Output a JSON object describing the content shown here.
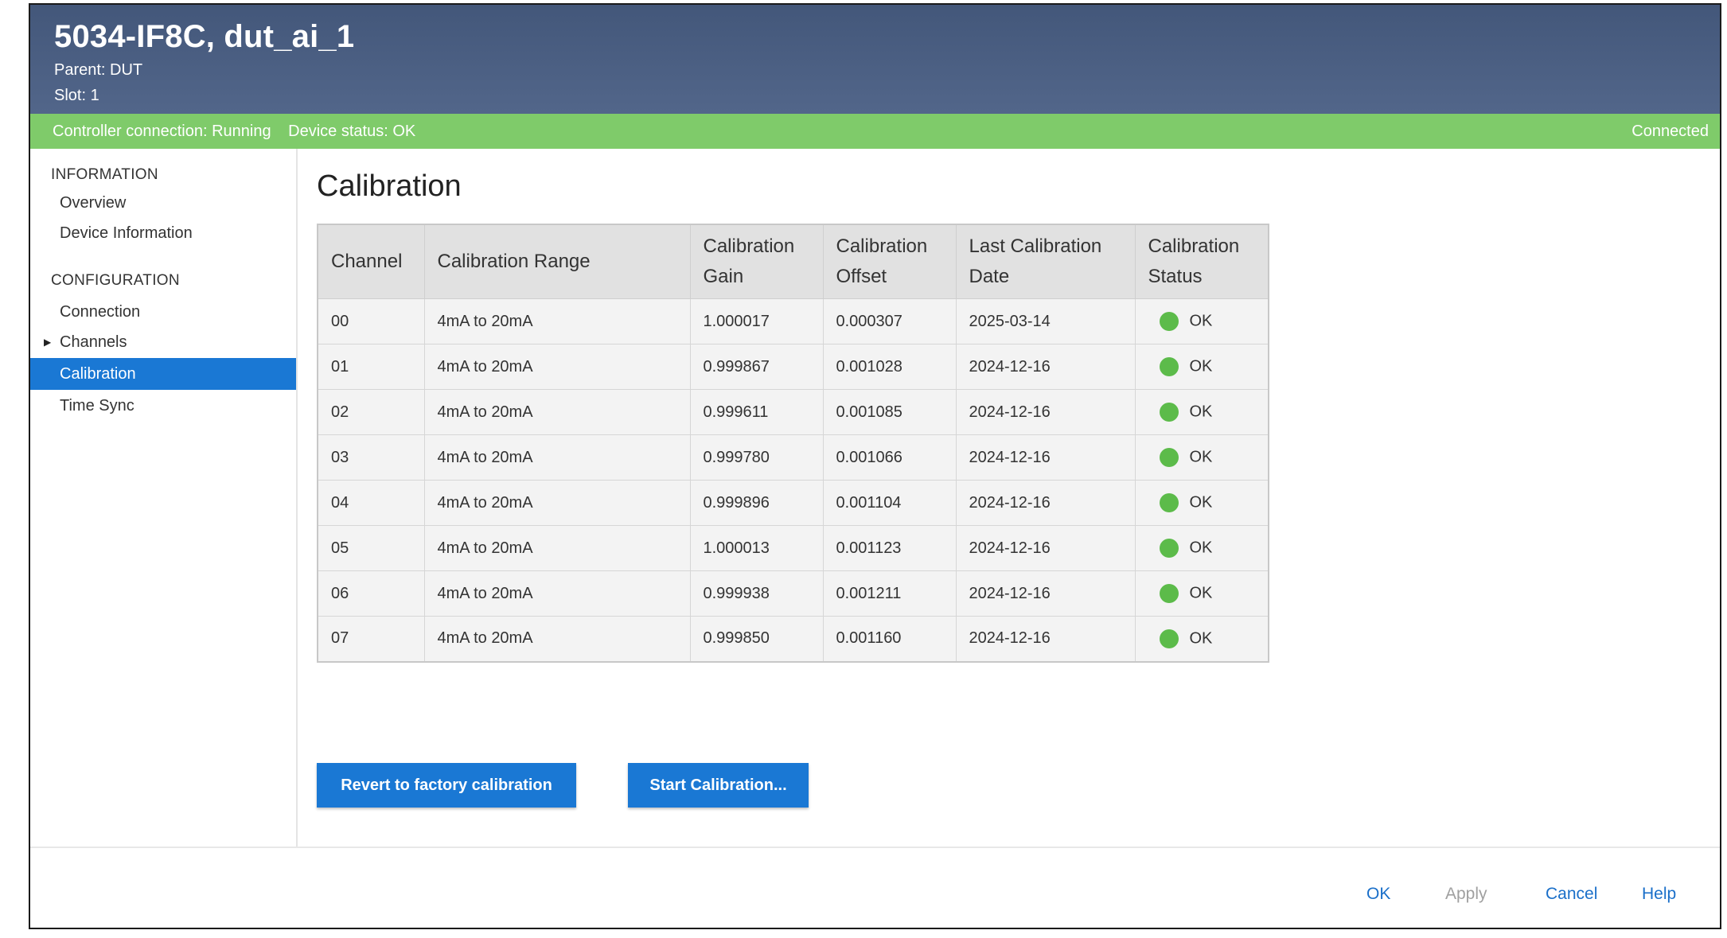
{
  "header": {
    "title": "5034-IF8C, dut_ai_1",
    "parent": "Parent: DUT",
    "slot": "Slot: 1"
  },
  "statusbar": {
    "controller": "Controller connection: Running",
    "device": "Device status: OK",
    "connection": "Connected"
  },
  "sidebar": {
    "section_information": "INFORMATION",
    "section_configuration": "CONFIGURATION",
    "items": [
      {
        "label": "Overview"
      },
      {
        "label": "Device Information"
      },
      {
        "label": "Connection"
      },
      {
        "label": "Channels"
      },
      {
        "label": "Calibration"
      },
      {
        "label": "Time Sync"
      }
    ]
  },
  "main": {
    "title": "Calibration",
    "columns": [
      "Channel",
      "Calibration Range",
      "Calibration Gain",
      "Calibration Offset",
      "Last Calibration Date",
      "Calibration Status"
    ],
    "rows": [
      {
        "channel": "00",
        "range": "4mA to 20mA",
        "gain": "1.000017",
        "offset": "0.000307",
        "date": "2025-03-14",
        "status": "OK"
      },
      {
        "channel": "01",
        "range": "4mA to 20mA",
        "gain": "0.999867",
        "offset": "0.001028",
        "date": "2024-12-16",
        "status": "OK"
      },
      {
        "channel": "02",
        "range": "4mA to 20mA",
        "gain": "0.999611",
        "offset": "0.001085",
        "date": "2024-12-16",
        "status": "OK"
      },
      {
        "channel": "03",
        "range": "4mA to 20mA",
        "gain": "0.999780",
        "offset": "0.001066",
        "date": "2024-12-16",
        "status": "OK"
      },
      {
        "channel": "04",
        "range": "4mA to 20mA",
        "gain": "0.999896",
        "offset": "0.001104",
        "date": "2024-12-16",
        "status": "OK"
      },
      {
        "channel": "05",
        "range": "4mA to 20mA",
        "gain": "1.000013",
        "offset": "0.001123",
        "date": "2024-12-16",
        "status": "OK"
      },
      {
        "channel": "06",
        "range": "4mA to 20mA",
        "gain": "0.999938",
        "offset": "0.001211",
        "date": "2024-12-16",
        "status": "OK"
      },
      {
        "channel": "07",
        "range": "4mA to 20mA",
        "gain": "0.999850",
        "offset": "0.001160",
        "date": "2024-12-16",
        "status": "OK"
      }
    ],
    "revert_button": "Revert to factory calibration",
    "start_button": "Start Calibration..."
  },
  "footer": {
    "ok": "OK",
    "apply": "Apply",
    "cancel": "Cancel",
    "help": "Help"
  },
  "colors": {
    "header_bg": "#4a5e82",
    "status_bar": "#7fcb6a",
    "accent": "#1a78d4",
    "status_ok": "#5cbb4a"
  }
}
